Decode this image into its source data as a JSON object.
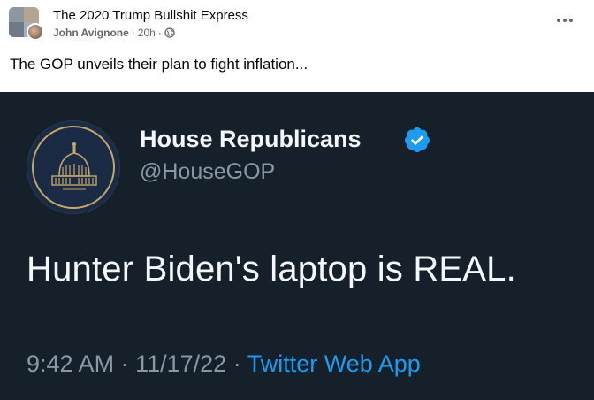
{
  "post": {
    "group_name": "The 2020 Trump Bullshit Express",
    "author": "John Avignone",
    "separator": "·",
    "time": "20h",
    "separator2": "·",
    "text": "The GOP unveils their plan to fight inflation..."
  },
  "tweet": {
    "display_name": "House Republicans",
    "handle": "@HouseGOP",
    "body": "Hunter Biden's laptop is REAL.",
    "time": "9:42 AM",
    "dot1": "·",
    "date": "11/17/22",
    "dot2": "·",
    "source": "Twitter Web App"
  },
  "icons": {
    "more": "more-horizontal-icon",
    "privacy": "globe-icon",
    "verified": "verified-badge-icon"
  },
  "colors": {
    "tweet_bg": "#15202b",
    "link_blue": "#1d9bf0",
    "muted": "#8899a6",
    "gold_seal": "#c3a866"
  }
}
